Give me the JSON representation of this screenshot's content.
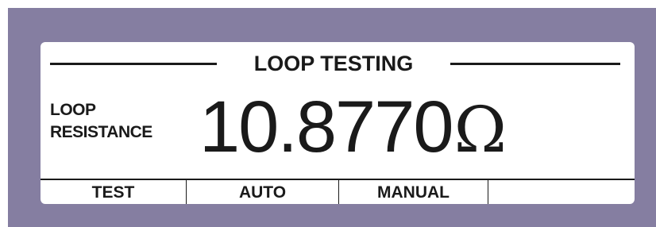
{
  "display": {
    "title": "LOOP TESTING",
    "measurement_label_line1": "LOOP",
    "measurement_label_line2": "RESISTANCE",
    "reading_value": "10.8770",
    "reading_unit": "Ω"
  },
  "softkeys": [
    {
      "label": "TEST"
    },
    {
      "label": "AUTO"
    },
    {
      "label": "MANUAL"
    },
    {
      "label": ""
    }
  ],
  "colors": {
    "bezel": "#857ea1",
    "screen_background": "#ffffff",
    "text": "#1a1a1a"
  }
}
